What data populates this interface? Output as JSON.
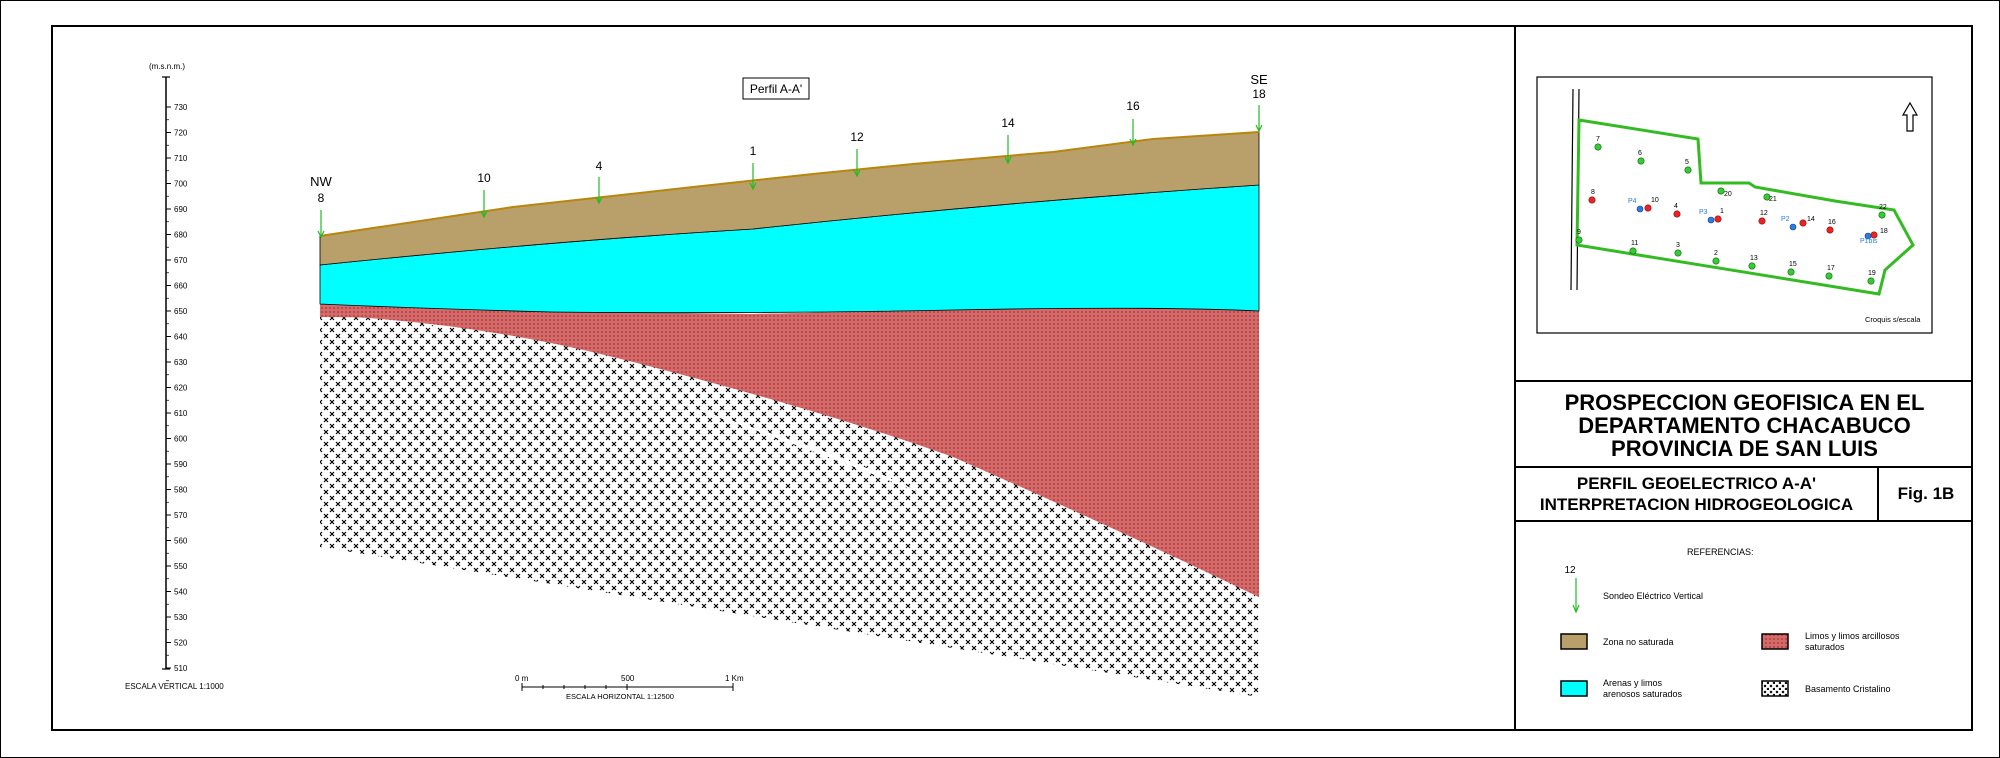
{
  "profile": {
    "title": "Perfil A-A'",
    "nw": "NW",
    "se": "SE",
    "y_unit": "(m.s.n.m.)",
    "y_ticks": [
      "730",
      "720",
      "710",
      "700",
      "690",
      "680",
      "670",
      "660",
      "650",
      "640",
      "630",
      "620",
      "610",
      "600",
      "590",
      "580",
      "570",
      "560",
      "550",
      "540",
      "530",
      "520",
      "510"
    ],
    "vertical_scale": "ESCALA VERTICAL 1:1000",
    "horizontal_scale": "ESCALA HORIZONTAL 1:12500",
    "hscale_ticks": [
      "0 m",
      "500",
      "1 Km"
    ],
    "soundings": [
      "8",
      "10",
      "4",
      "1",
      "12",
      "14",
      "16",
      "18"
    ]
  },
  "map": {
    "points_green": [
      "7",
      "6",
      "5",
      "20",
      "21",
      "22",
      "9",
      "11",
      "3",
      "2",
      "13",
      "15",
      "17",
      "19"
    ],
    "points_red": [
      "8",
      "10",
      "4",
      "1",
      "12",
      "14",
      "16",
      "18"
    ],
    "points_blue": [
      "P4",
      "P3",
      "P2",
      "P1bis"
    ],
    "croquis": "Croquis s/escala"
  },
  "title": {
    "line1": "PROSPECCION GEOFISICA EN EL",
    "line2": "DEPARTAMENTO CHACABUCO",
    "line3": "PROVINCIA DE SAN LUIS"
  },
  "subtitle": {
    "line1": "PERFIL GEOELECTRICO A-A'",
    "line2": "INTERPRETACION HIDROGEOLOGICA"
  },
  "fig": "Fig. 1B",
  "legend": {
    "heading": "REFERENCIAS:",
    "sev_number": "12",
    "sev": "Sondeo Eléctrico Vertical",
    "zona": "Zona no saturada",
    "arenas1": "Arenas y limos",
    "arenas2": "arenosos saturados",
    "limos1": "Limos y limos arcillosos",
    "limos2": "saturados",
    "basamento": "Basamento Cristalino"
  },
  "colors": {
    "unsaturated": "#b9a06a",
    "unsaturated_top": "#b8860b",
    "sands": "#00ffff",
    "silts": "#d46a6a",
    "sev_marker": "#22bb22",
    "map_outline": "#33bb22"
  }
}
